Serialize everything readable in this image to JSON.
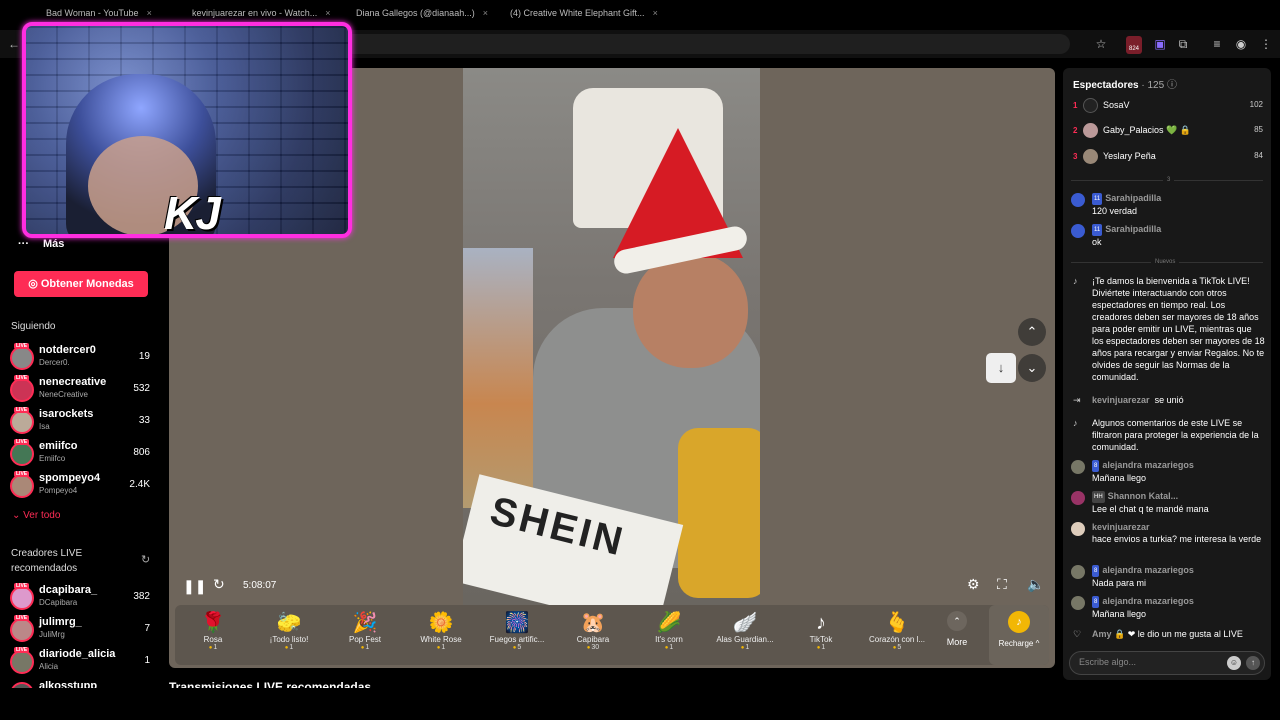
{
  "browser": {
    "tabs": [
      {
        "label": "Bad Woman - YouTube"
      },
      {
        "label": "kevinjuarezar en vivo - Watch..."
      },
      {
        "label": "Diana Gallegos (@dianaah...)"
      },
      {
        "label": "(4) Creative White Elephant Gift..."
      }
    ],
    "extension_badge": "824"
  },
  "webcam": {
    "initials": "KJ"
  },
  "sidebar": {
    "more_label": "Más",
    "coins_button": "Obtener Monedas",
    "following_title": "Siguiendo",
    "following": [
      {
        "name": "notdercer0",
        "sub": "Dercer0.",
        "count": "19"
      },
      {
        "name": "nenecreative",
        "sub": "NeneCreative",
        "count": "532"
      },
      {
        "name": "isarockets",
        "sub": "Isa",
        "count": "33"
      },
      {
        "name": "emiifco",
        "sub": "Emiifco",
        "count": "806"
      },
      {
        "name": "spompeyo4",
        "sub": "Pompeyo4",
        "count": "2.4K"
      }
    ],
    "see_all": "Ver todo",
    "recommended_title": "Creadores LIVE recomendados",
    "recommended": [
      {
        "name": "dcapibara_",
        "sub": "DCapibara",
        "count": "382"
      },
      {
        "name": "julimrg_",
        "sub": "JuliMrg",
        "count": "7"
      },
      {
        "name": "diariode_alicia",
        "sub": "Alicia",
        "count": "1"
      },
      {
        "name": "alkosstupp",
        "sub": "",
        "count": ""
      }
    ]
  },
  "player": {
    "timecode": "5:08:07",
    "video_text": "SHEIN",
    "gifts": [
      {
        "name": "Rosa",
        "price": "1",
        "icon": "🌹"
      },
      {
        "name": "¡Todo listo!",
        "price": "1",
        "icon": "🧽"
      },
      {
        "name": "Pop Fest",
        "price": "1",
        "icon": "🎉"
      },
      {
        "name": "White Rose",
        "price": "1",
        "icon": "🌼"
      },
      {
        "name": "Fuegos artific...",
        "price": "5",
        "icon": "🎆"
      },
      {
        "name": "Capibara",
        "price": "30",
        "icon": "🐹"
      },
      {
        "name": "It's corn",
        "price": "1",
        "icon": "🌽"
      },
      {
        "name": "Alas Guardian...",
        "price": "1",
        "icon": "🪽"
      },
      {
        "name": "TikTok",
        "price": "1",
        "icon": "♪"
      },
      {
        "name": "Corazón con l...",
        "price": "5",
        "icon": "🫰"
      }
    ],
    "more_label": "More",
    "recharge_label": "Recharge ^"
  },
  "recommended_live_title": "Transmisiones LIVE recomendadas",
  "chat_panel": {
    "viewers_title": "Espectadores",
    "viewers_count": "· 125",
    "top_viewers": [
      {
        "rank": "1",
        "name": "SosaV",
        "score": "102"
      },
      {
        "rank": "2",
        "name": "Gaby_Palacios 💚 🔒",
        "score": "85"
      },
      {
        "rank": "3",
        "name": "Yeslary Peña",
        "score": "84"
      }
    ],
    "top_sep": "3",
    "messages_before": [
      {
        "level": "11",
        "user": "Sarahipadilla",
        "text": "120 verdad"
      },
      {
        "level": "11",
        "user": "Sarahipadilla",
        "text": "ok"
      }
    ],
    "new_label": "Nuevos",
    "system_welcome": "¡Te damos la bienvenida a TikTok LIVE! Diviértete interactuando con otros espectadores en tiempo real. Los creadores deben ser mayores de 18 años para poder emitir un LIVE, mientras que los espectadores deben ser mayores de 18 años para recargar y enviar Regalos. No te olvides de seguir las Normas de la comunidad.",
    "joined_user": "kevinjuarezar",
    "joined_text": "se unió",
    "system_filtered": "Algunos comentarios de este LIVE se filtraron para proteger la experiencia de la comunidad.",
    "messages_after": [
      {
        "level": "8",
        "user": "alejandra mazariegos",
        "text": "Mañana llego"
      },
      {
        "level": "HH",
        "user": "Shannon Katal...",
        "text": "Lee el chat q te mandé mana"
      },
      {
        "level": "",
        "user": "kevinjuarezar",
        "text": "hace envios a turkia? me interesa la verde"
      },
      {
        "level": "8",
        "user": "alejandra mazariegos",
        "text": "Nada para mi"
      },
      {
        "level": "8",
        "user": "alejandra mazariegos",
        "text": "Mañana llego"
      }
    ],
    "like_user": "Amy",
    "like_text": "le dio un me gusta al LIVE",
    "input_placeholder": "Escribe algo..."
  }
}
